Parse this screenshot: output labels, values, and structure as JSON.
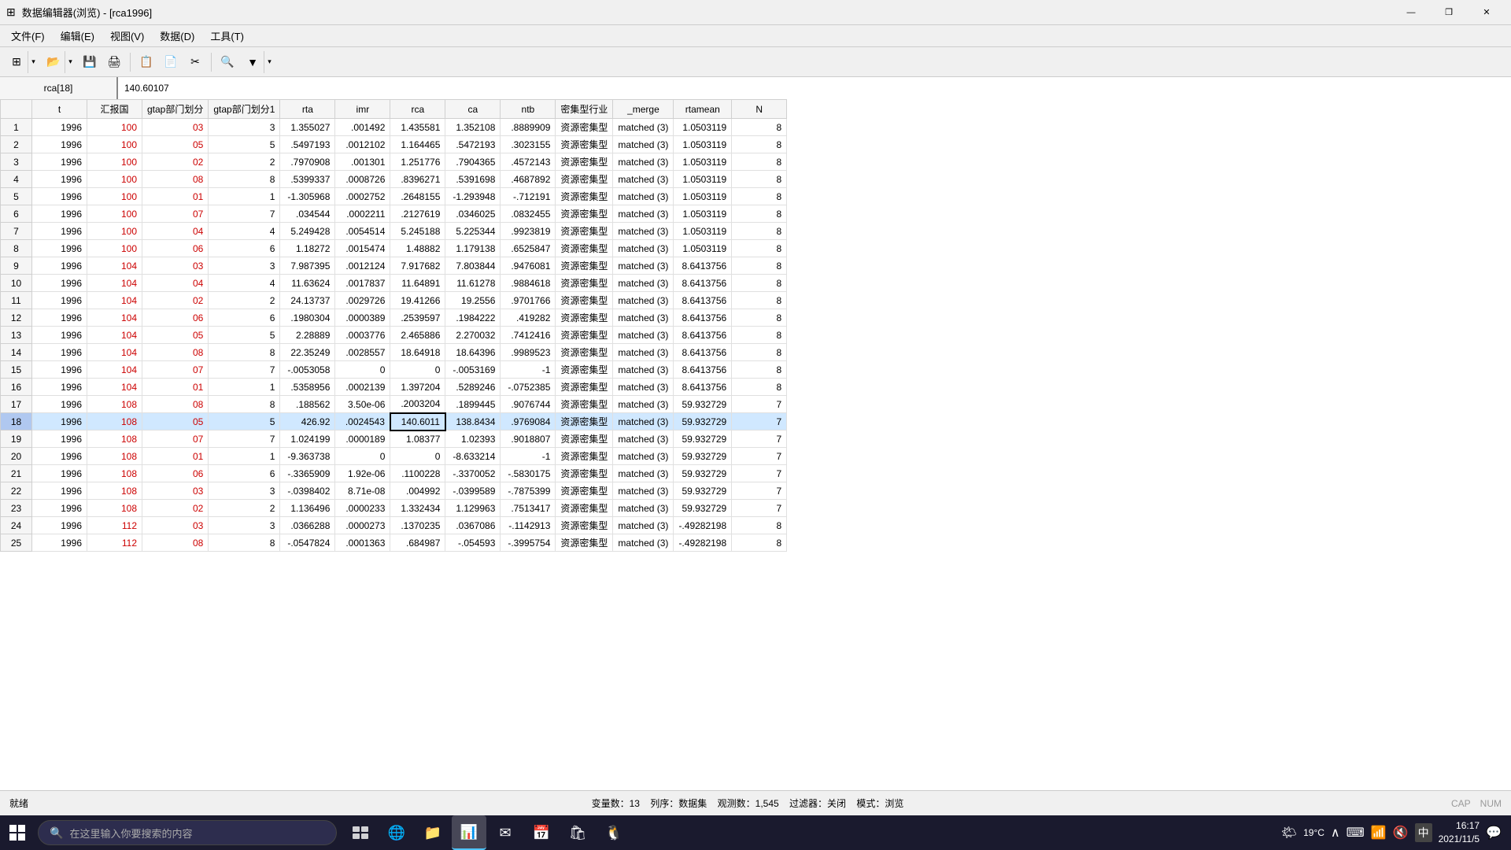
{
  "window": {
    "title": "数据编辑器(浏览) - [rca1996]",
    "icon": "⊞"
  },
  "menu": {
    "items": [
      "文件(F)",
      "编辑(E)",
      "视图(V)",
      "数据(D)",
      "工具(T)"
    ]
  },
  "formula_bar": {
    "cell_ref": "rca[18]",
    "cell_value": "140.60107"
  },
  "columns": [
    "",
    "t",
    "汇报国",
    "gtap部门划分",
    "gtap部门划分1",
    "rta",
    "imr",
    "rca",
    "ca",
    "ntb",
    "密集型行业",
    "_merge",
    "rtamean",
    "N"
  ],
  "rows": [
    {
      "row": 1,
      "t": "1996",
      "hbg": "100",
      "gtap1": "03",
      "gtap2": "3",
      "rta": "1.355027",
      "imr": ".001492",
      "rca": "1.435581",
      "ca": "1.352108",
      "ntb": ".8889909",
      "mj": "资源密集型",
      "merge": "matched (3)",
      "rtamean": "1.0503119",
      "n": "8"
    },
    {
      "row": 2,
      "t": "1996",
      "hbg": "100",
      "gtap1": "05",
      "gtap2": "5",
      "rta": ".5497193",
      "imr": ".0012102",
      "rca": "1.164465",
      "ca": ".5472193",
      "ntb": ".3023155",
      "mj": "资源密集型",
      "merge": "matched (3)",
      "rtamean": "1.0503119",
      "n": "8"
    },
    {
      "row": 3,
      "t": "1996",
      "hbg": "100",
      "gtap1": "02",
      "gtap2": "2",
      "rta": ".7970908",
      "imr": ".001301",
      "rca": "1.251776",
      "ca": ".7904365",
      "ntb": ".4572143",
      "mj": "资源密集型",
      "merge": "matched (3)",
      "rtamean": "1.0503119",
      "n": "8"
    },
    {
      "row": 4,
      "t": "1996",
      "hbg": "100",
      "gtap1": "08",
      "gtap2": "8",
      "rta": ".5399337",
      "imr": ".0008726",
      "rca": ".8396271",
      "ca": ".5391698",
      "ntb": ".4687892",
      "mj": "资源密集型",
      "merge": "matched (3)",
      "rtamean": "1.0503119",
      "n": "8"
    },
    {
      "row": 5,
      "t": "1996",
      "hbg": "100",
      "gtap1": "01",
      "gtap2": "1",
      "rta": "-1.305968",
      "imr": ".0002752",
      "rca": ".2648155",
      "ca": "-1.293948",
      "ntb": "-.712191",
      "mj": "资源密集型",
      "merge": "matched (3)",
      "rtamean": "1.0503119",
      "n": "8"
    },
    {
      "row": 6,
      "t": "1996",
      "hbg": "100",
      "gtap1": "07",
      "gtap2": "7",
      "rta": ".034544",
      "imr": ".0002211",
      "rca": ".2127619",
      "ca": ".0346025",
      "ntb": ".0832455",
      "mj": "资源密集型",
      "merge": "matched (3)",
      "rtamean": "1.0503119",
      "n": "8"
    },
    {
      "row": 7,
      "t": "1996",
      "hbg": "100",
      "gtap1": "04",
      "gtap2": "4",
      "rta": "5.249428",
      "imr": ".0054514",
      "rca": "5.245188",
      "ca": "5.225344",
      "ntb": ".9923819",
      "mj": "资源密集型",
      "merge": "matched (3)",
      "rtamean": "1.0503119",
      "n": "8"
    },
    {
      "row": 8,
      "t": "1996",
      "hbg": "100",
      "gtap1": "06",
      "gtap2": "6",
      "rta": "1.18272",
      "imr": ".0015474",
      "rca": "1.48882",
      "ca": "1.179138",
      "ntb": ".6525847",
      "mj": "资源密集型",
      "merge": "matched (3)",
      "rtamean": "1.0503119",
      "n": "8"
    },
    {
      "row": 9,
      "t": "1996",
      "hbg": "104",
      "gtap1": "03",
      "gtap2": "3",
      "rta": "7.987395",
      "imr": ".0012124",
      "rca": "7.917682",
      "ca": "7.803844",
      "ntb": ".9476081",
      "mj": "资源密集型",
      "merge": "matched (3)",
      "rtamean": "8.6413756",
      "n": "8"
    },
    {
      "row": 10,
      "t": "1996",
      "hbg": "104",
      "gtap1": "04",
      "gtap2": "4",
      "rta": "11.63624",
      "imr": ".0017837",
      "rca": "11.64891",
      "ca": "11.61278",
      "ntb": ".9884618",
      "mj": "资源密集型",
      "merge": "matched (3)",
      "rtamean": "8.6413756",
      "n": "8"
    },
    {
      "row": 11,
      "t": "1996",
      "hbg": "104",
      "gtap1": "02",
      "gtap2": "2",
      "rta": "24.13737",
      "imr": ".0029726",
      "rca": "19.41266",
      "ca": "19.2556",
      "ntb": ".9701766",
      "mj": "资源密集型",
      "merge": "matched (3)",
      "rtamean": "8.6413756",
      "n": "8"
    },
    {
      "row": 12,
      "t": "1996",
      "hbg": "104",
      "gtap1": "06",
      "gtap2": "6",
      "rta": ".1980304",
      "imr": ".0000389",
      "rca": ".2539597",
      "ca": ".1984222",
      "ntb": ".419282",
      "mj": "资源密集型",
      "merge": "matched (3)",
      "rtamean": "8.6413756",
      "n": "8"
    },
    {
      "row": 13,
      "t": "1996",
      "hbg": "104",
      "gtap1": "05",
      "gtap2": "5",
      "rta": "2.28889",
      "imr": ".0003776",
      "rca": "2.465886",
      "ca": "2.270032",
      "ntb": ".7412416",
      "mj": "资源密集型",
      "merge": "matched (3)",
      "rtamean": "8.6413756",
      "n": "8"
    },
    {
      "row": 14,
      "t": "1996",
      "hbg": "104",
      "gtap1": "08",
      "gtap2": "8",
      "rta": "22.35249",
      "imr": ".0028557",
      "rca": "18.64918",
      "ca": "18.64396",
      "ntb": ".9989523",
      "mj": "资源密集型",
      "merge": "matched (3)",
      "rtamean": "8.6413756",
      "n": "8"
    },
    {
      "row": 15,
      "t": "1996",
      "hbg": "104",
      "gtap1": "07",
      "gtap2": "7",
      "rta": "-.0053058",
      "imr": "0",
      "rca": "0",
      "ca": "-.0053169",
      "ntb": "-1",
      "mj": "资源密集型",
      "merge": "matched (3)",
      "rtamean": "8.6413756",
      "n": "8"
    },
    {
      "row": 16,
      "t": "1996",
      "hbg": "104",
      "gtap1": "01",
      "gtap2": "1",
      "rta": ".5358956",
      "imr": ".0002139",
      "rca": "1.397204",
      "ca": ".5289246",
      "ntb": "-.0752385",
      "mj": "资源密集型",
      "merge": "matched (3)",
      "rtamean": "8.6413756",
      "n": "8"
    },
    {
      "row": 17,
      "t": "1996",
      "hbg": "108",
      "gtap1": "08",
      "gtap2": "8",
      "rta": ".188562",
      "imr": "3.50e-06",
      "rca": ".2003204",
      "ca": ".1899445",
      "ntb": ".9076744",
      "mj": "资源密集型",
      "merge": "matched (3)",
      "rtamean": "59.932729",
      "n": "7"
    },
    {
      "row": 18,
      "t": "1996",
      "hbg": "108",
      "gtap1": "05",
      "gtap2": "5",
      "rta": "426.92",
      "imr": ".0024543",
      "rca": "140.6011",
      "ca": "138.8434",
      "ntb": ".9769084",
      "mj": "资源密集型",
      "merge": "matched (3)",
      "rtamean": "59.932729",
      "n": "7",
      "selected": true
    },
    {
      "row": 19,
      "t": "1996",
      "hbg": "108",
      "gtap1": "07",
      "gtap2": "7",
      "rta": "1.024199",
      "imr": ".0000189",
      "rca": "1.08377",
      "ca": "1.02393",
      "ntb": ".9018807",
      "mj": "资源密集型",
      "merge": "matched (3)",
      "rtamean": "59.932729",
      "n": "7"
    },
    {
      "row": 20,
      "t": "1996",
      "hbg": "108",
      "gtap1": "01",
      "gtap2": "1",
      "rta": "-9.363738",
      "imr": "0",
      "rca": "0",
      "ca": "-8.633214",
      "ntb": "-1",
      "mj": "资源密集型",
      "merge": "matched (3)",
      "rtamean": "59.932729",
      "n": "7"
    },
    {
      "row": 21,
      "t": "1996",
      "hbg": "108",
      "gtap1": "06",
      "gtap2": "6",
      "rta": "-.3365909",
      "imr": "1.92e-06",
      "rca": ".1100228",
      "ca": "-.3370052",
      "ntb": "-.5830175",
      "mj": "资源密集型",
      "merge": "matched (3)",
      "rtamean": "59.932729",
      "n": "7"
    },
    {
      "row": 22,
      "t": "1996",
      "hbg": "108",
      "gtap1": "03",
      "gtap2": "3",
      "rta": "-.0398402",
      "imr": "8.71e-08",
      "rca": ".004992",
      "ca": "-.0399589",
      "ntb": "-.7875399",
      "mj": "资源密集型",
      "merge": "matched (3)",
      "rtamean": "59.932729",
      "n": "7"
    },
    {
      "row": 23,
      "t": "1996",
      "hbg": "108",
      "gtap1": "02",
      "gtap2": "2",
      "rta": "1.136496",
      "imr": ".0000233",
      "rca": "1.332434",
      "ca": "1.129963",
      "ntb": ".7513417",
      "mj": "资源密集型",
      "merge": "matched (3)",
      "rtamean": "59.932729",
      "n": "7"
    },
    {
      "row": 24,
      "t": "1996",
      "hbg": "112",
      "gtap1": "03",
      "gtap2": "3",
      "rta": ".0366288",
      "imr": ".0000273",
      "rca": ".1370235",
      "ca": ".0367086",
      "ntb": "-.1142913",
      "mj": "资源密集型",
      "merge": "matched (3)",
      "rtamean": "-.49282198",
      "n": "8"
    },
    {
      "row": 25,
      "t": "1996",
      "hbg": "112",
      "gtap1": "08",
      "gtap2": "8",
      "rta": "-.0547824",
      "imr": ".0001363",
      "rca": ".684987",
      "ca": "-.054593",
      "ntb": "-.3995754",
      "mj": "资源密集型",
      "merge": "matched (3)",
      "rtamean": "-.49282198",
      "n": "8"
    }
  ],
  "status": {
    "ready": "就绪",
    "vars": "变量数：13",
    "col": "列序：数据集",
    "obs": "观测数：1,545",
    "filter": "过滤器：关闭",
    "mode": "模式：浏览",
    "caps": "CAP",
    "num": "NUM"
  },
  "taskbar": {
    "search_placeholder": "在这里输入你要搜索的内容",
    "time": "16:17",
    "date": "2021/11/5",
    "temp": "19°C",
    "locale": "中"
  }
}
